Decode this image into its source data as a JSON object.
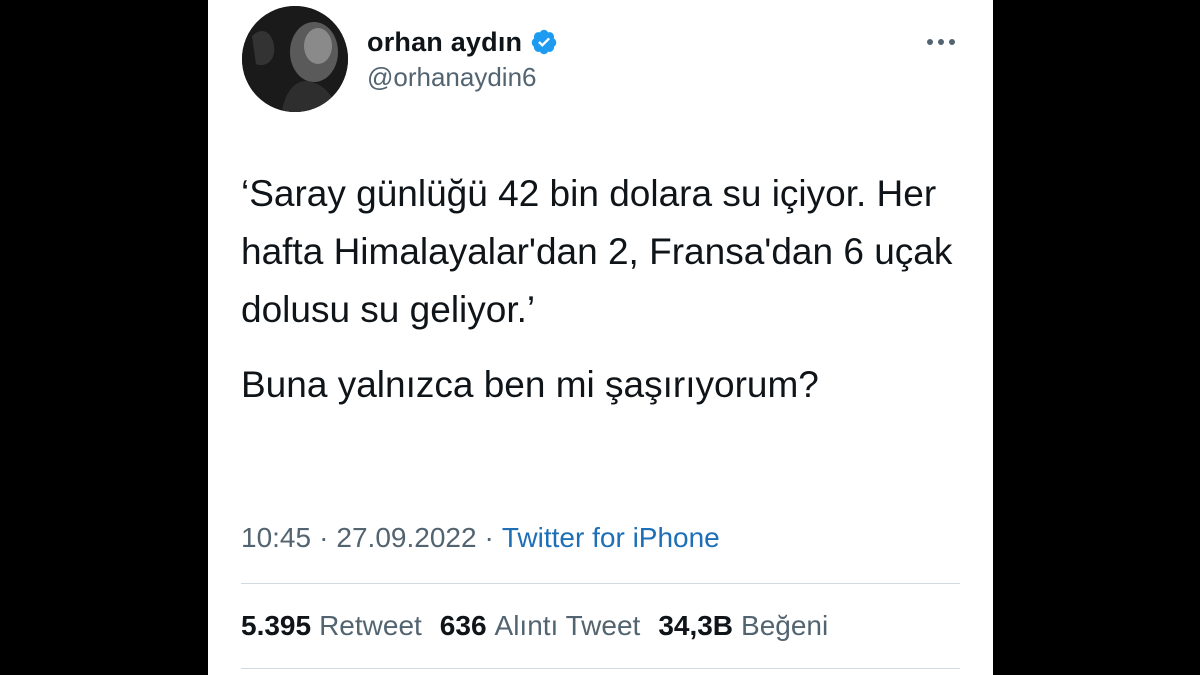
{
  "author": {
    "name": "orhan aydın",
    "handle": "@orhanaydin6",
    "verified": true
  },
  "tweet": {
    "paragraphs": [
      "‘Saray günlüğü 42 bin dolara su içiyor. Her hafta Himalayalar'dan 2, Fransa'dan 6 uçak dolusu su geliyor.’",
      "Buna yalnızca ben mi şaşırıyorum?"
    ]
  },
  "meta": {
    "time": "10:45",
    "date": "27.09.2022",
    "separator": "·",
    "source": "Twitter for iPhone"
  },
  "stats": {
    "retweets": {
      "count": "5.395",
      "label": "Retweet"
    },
    "quotes": {
      "count": "636",
      "label": "Alıntı Tweet"
    },
    "likes": {
      "count": "34,3B",
      "label": "Beğeni"
    }
  },
  "icons": {
    "verified": "verified-badge-icon",
    "more": "more-options-icon"
  },
  "colors": {
    "text_primary": "#0f1419",
    "text_secondary": "#536471",
    "link": "#1d6fb8",
    "verified": "#1d9bf0",
    "divider": "#cfd9de",
    "page_background": "#000000",
    "card_background": "#ffffff"
  }
}
